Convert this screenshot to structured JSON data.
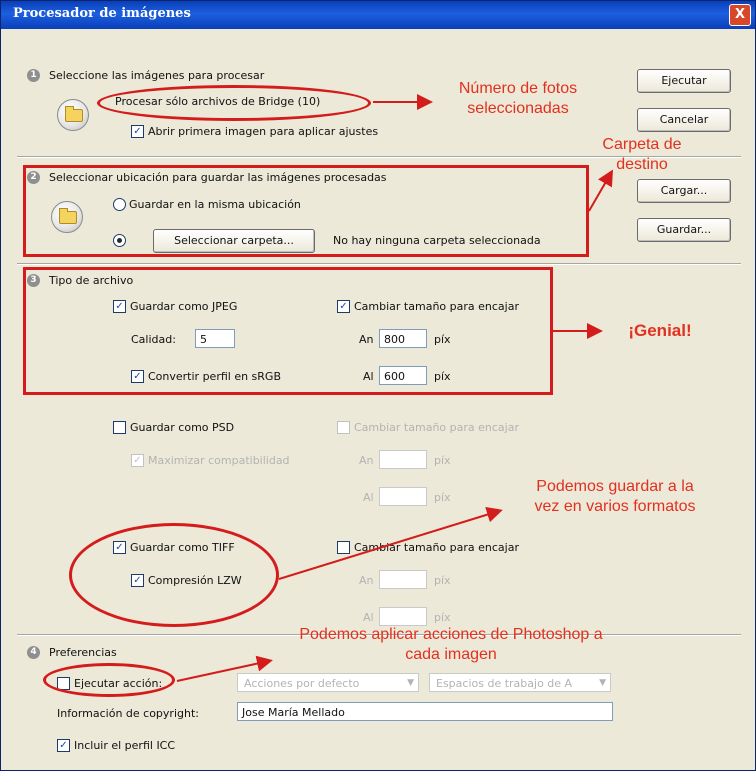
{
  "window": {
    "title": "Procesador de imágenes",
    "close_glyph": "X"
  },
  "step_numbers": [
    "1",
    "2",
    "3",
    "4"
  ],
  "section1": {
    "heading": "Seleccione las imágenes para procesar",
    "source_text": "Procesar sólo archivos de Bridge (10)",
    "open_first_label": "Abrir primera imagen para aplicar ajustes",
    "open_first_checked": true
  },
  "section2": {
    "heading": "Seleccionar ubicación para guardar las imágenes procesadas",
    "same_location_label": "Guardar en la misma ubicación",
    "same_location_selected": false,
    "select_folder_button": "Seleccionar carpeta...",
    "folder_status": "No hay ninguna carpeta seleccionada",
    "folder_selected": true
  },
  "section3": {
    "heading": "Tipo de archivo",
    "jpeg": {
      "save_label": "Guardar como JPEG",
      "save_checked": true,
      "resize_label": "Cambiar tamaño para encajar",
      "resize_checked": true,
      "quality_label": "Calidad:",
      "quality_value": "5",
      "width_label": "An",
      "width_value": "800",
      "height_label": "Al",
      "height_value": "600",
      "unit": "píx",
      "srgb_label": "Convertir perfil en sRGB",
      "srgb_checked": true
    },
    "psd": {
      "save_label": "Guardar como PSD",
      "save_checked": false,
      "resize_label": "Cambiar tamaño para encajar",
      "resize_checked": false,
      "maximize_label": "Maximizar compatibilidad",
      "maximize_checked": true,
      "width_label": "An",
      "width_value": "",
      "height_label": "Al",
      "height_value": "",
      "unit": "píx"
    },
    "tiff": {
      "save_label": "Guardar como TIFF",
      "save_checked": true,
      "resize_label": "Cambiar tamaño para encajar",
      "resize_checked": false,
      "lzw_label": "Compresión LZW",
      "lzw_checked": true,
      "width_label": "An",
      "width_value": "",
      "height_label": "Al",
      "height_value": "",
      "unit": "píx"
    }
  },
  "section4": {
    "heading": "Preferencias",
    "run_action_label": "Ejecutar acción:",
    "run_action_checked": false,
    "action_set": "Acciones por defecto",
    "action": "Espacios de trabajo de A",
    "copyright_label": "Información de copyright:",
    "copyright_value": "Jose María Mellado",
    "icc_label": "Incluir el perfil ICC",
    "icc_checked": true
  },
  "buttons": {
    "run": "Ejecutar",
    "cancel": "Cancelar",
    "load": "Cargar...",
    "save": "Guardar..."
  },
  "annotations": {
    "photo_count": "Número de fotos\nseleccionadas",
    "destination": "Carpeta de\ndestino",
    "great": "¡Genial!",
    "multi_format": "Podemos guardar a la\nvez en varios formatos",
    "actions": "Podemos aplicar acciones de Photoshop a\ncada imagen"
  },
  "colors": {
    "annotation_red": "#e3301f",
    "titlebar_blue": "#1c5fe0",
    "dialog_bg": "#ece9d8"
  }
}
